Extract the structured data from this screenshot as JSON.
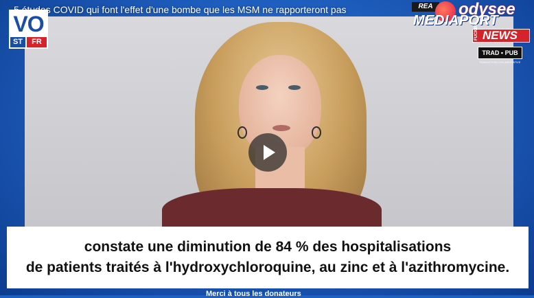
{
  "video": {
    "title": "5 études COVID qui font l'effet d'une bombe que les MSM ne rapporteront pas"
  },
  "logo": {
    "main": "VO",
    "st": "ST",
    "fr": "FR"
  },
  "branding": {
    "rea": "REA",
    "odysee": "odysee",
    "mediaport": "MEDIAPORT",
    "fucking": "FUCKING",
    "news": "NEWS",
    "trad_pub": "TRAD • PUB",
    "trad_sub": "TRADUCTION COLLABORATIVE"
  },
  "subtitles": {
    "line1": "constate une diminution de 84 % des hospitalisations",
    "line2": "de patients traités à l'hydroxychloroquine, au zinc et à l'azithromycine."
  },
  "ticker": {
    "text": "Merci à tous les donateurs"
  },
  "colors": {
    "background": "#1f5fbf",
    "logo_blue": "#1b4ea3",
    "logo_red": "#d4232b",
    "news_red": "#d4232b"
  },
  "icons": {
    "play": "play-icon",
    "odysee": "odysee-logo-icon"
  }
}
